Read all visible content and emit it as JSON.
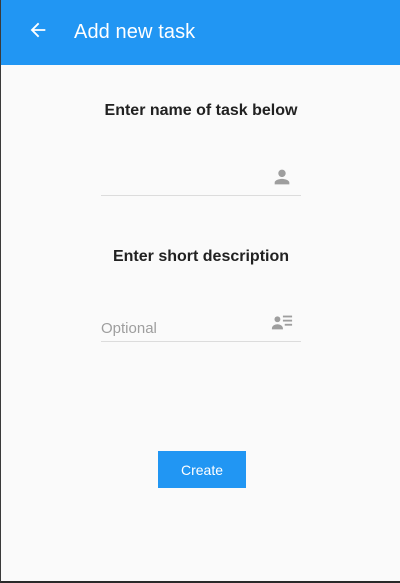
{
  "appbar": {
    "title": "Add new task",
    "back_icon": "arrow-left-icon",
    "background_color": "#2196f3"
  },
  "task_name": {
    "label": "Enter name of task below",
    "value": "",
    "placeholder": "",
    "icon": "person-icon"
  },
  "task_description": {
    "label": "Enter short description",
    "value": "",
    "placeholder": "Optional",
    "icon": "contact-details-icon"
  },
  "actions": {
    "create_label": "Create",
    "create_color": "#2196f3"
  }
}
